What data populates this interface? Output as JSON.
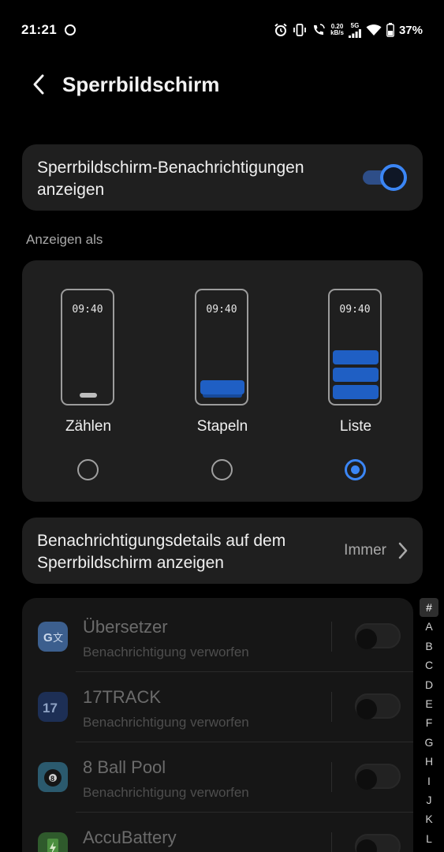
{
  "status_bar": {
    "time": "21:21",
    "speed_top": "0.20",
    "speed_bottom": "kB/s",
    "network": "5G",
    "battery": "37%"
  },
  "header": {
    "title": "Sperrbildschirm"
  },
  "lock_notifications": {
    "label": "Sperrbildschirm-Benachrichtigungen anzeigen",
    "enabled": true
  },
  "display_as": {
    "section_label": "Anzeigen als",
    "options": [
      {
        "label": "Zählen",
        "clock": "09:40",
        "selected": false
      },
      {
        "label": "Stapeln",
        "clock": "09:40",
        "selected": false
      },
      {
        "label": "Liste",
        "clock": "09:40",
        "selected": true
      }
    ]
  },
  "details": {
    "label": "Benachrichtigungsdetails auf dem Sperrbildschirm anzeigen",
    "value": "Immer"
  },
  "apps": [
    {
      "name": "Übersetzer",
      "status": "Benachrichtigung verworfen",
      "icon": "translate-icon",
      "enabled": false
    },
    {
      "name": "17TRACK",
      "status": "Benachrichtigung verworfen",
      "icon": "17track-icon",
      "enabled": false
    },
    {
      "name": "8 Ball Pool",
      "status": "Benachrichtigung verworfen",
      "icon": "8-ball-pool-icon",
      "enabled": false
    },
    {
      "name": "AccuBattery",
      "status": "",
      "icon": "accubattery-icon",
      "enabled": false
    }
  ],
  "alpha_index": [
    "#",
    "A",
    "B",
    "C",
    "D",
    "E",
    "F",
    "G",
    "H",
    "I",
    "J",
    "K",
    "L"
  ],
  "colors": {
    "accent": "#3b86f5",
    "card": "#1f1f1f",
    "background": "#000000"
  }
}
